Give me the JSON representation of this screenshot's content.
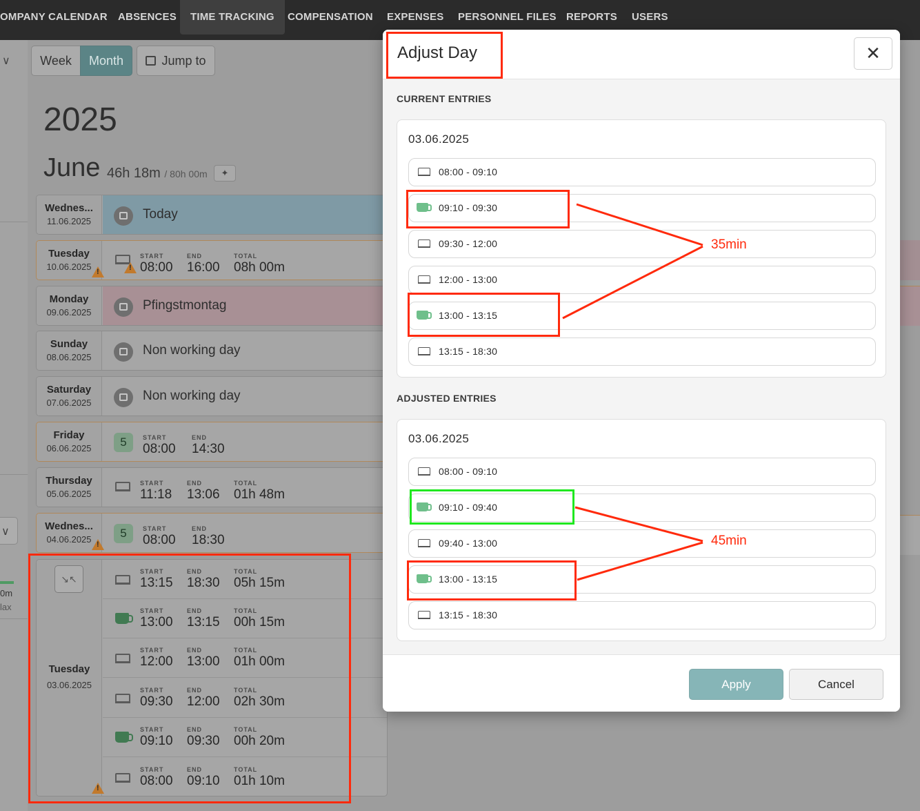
{
  "nav": {
    "items": [
      "OMPANY CALENDAR",
      "ABSENCES",
      "TIME TRACKING",
      "COMPENSATION",
      "EXPENSES",
      "PERSONNEL FILES",
      "REPORTS",
      "USERS"
    ],
    "active": "TIME TRACKING"
  },
  "toolbar": {
    "week": "Week",
    "month": "Month",
    "jump": "Jump to"
  },
  "calendar": {
    "year": "2025",
    "month": "June",
    "hours": "46h 18m",
    "target": "/ 80h 00m"
  },
  "labels": {
    "start": "START",
    "end": "END",
    "total": "TOTAL"
  },
  "days": [
    {
      "name": "Wednes...",
      "date": "11.06.2025",
      "type": "today",
      "label": "Today"
    },
    {
      "name": "Tuesday",
      "date": "10.06.2025",
      "type": "work",
      "start": "08:00",
      "end": "16:00",
      "total": "08h 00m"
    },
    {
      "name": "Monday",
      "date": "09.06.2025",
      "type": "holiday",
      "label": "Pfingstmontag"
    },
    {
      "name": "Sunday",
      "date": "08.06.2025",
      "type": "off",
      "label": "Non working day"
    },
    {
      "name": "Saturday",
      "date": "07.06.2025",
      "type": "off",
      "label": "Non working day"
    },
    {
      "name": "Friday",
      "date": "06.06.2025",
      "type": "badge",
      "badge": "5",
      "start": "08:00",
      "end": "14:30"
    },
    {
      "name": "Thursday",
      "date": "05.06.2025",
      "type": "work",
      "start": "11:18",
      "end": "13:06",
      "total": "01h 48m"
    },
    {
      "name": "Wednes...",
      "date": "04.06.2025",
      "type": "badge",
      "badge": "5",
      "start": "08:00",
      "end": "18:30"
    }
  ],
  "expanded_day": {
    "name": "Tuesday",
    "date": "03.06.2025",
    "entries": [
      {
        "kind": "work",
        "start": "13:15",
        "end": "18:30",
        "total": "05h 15m"
      },
      {
        "kind": "break",
        "start": "13:00",
        "end": "13:15",
        "total": "00h 15m"
      },
      {
        "kind": "work",
        "start": "12:00",
        "end": "13:00",
        "total": "01h 00m"
      },
      {
        "kind": "work",
        "start": "09:30",
        "end": "12:00",
        "total": "02h 30m"
      },
      {
        "kind": "break",
        "start": "09:10",
        "end": "09:30",
        "total": "00h 20m"
      },
      {
        "kind": "work",
        "start": "08:00",
        "end": "09:10",
        "total": "01h 10m"
      }
    ]
  },
  "sidebar_mini": {
    "line1": "0m",
    "line2": "lax"
  },
  "modal": {
    "title": "Adjust Day",
    "current_title": "CURRENT ENTRIES",
    "adjusted_title": "ADJUSTED ENTRIES",
    "current": {
      "date": "03.06.2025",
      "entries": [
        {
          "kind": "work",
          "time": "08:00 - 09:10"
        },
        {
          "kind": "break",
          "time": "09:10 - 09:30"
        },
        {
          "kind": "work",
          "time": "09:30 - 12:00"
        },
        {
          "kind": "work",
          "time": "12:00 - 13:00"
        },
        {
          "kind": "break",
          "time": "13:00 - 13:15"
        },
        {
          "kind": "work",
          "time": "13:15 - 18:30"
        }
      ]
    },
    "adjusted": {
      "date": "03.06.2025",
      "entries": [
        {
          "kind": "work",
          "time": "08:00 - 09:10"
        },
        {
          "kind": "break",
          "time": "09:10 - 09:40"
        },
        {
          "kind": "work",
          "time": "09:40 - 13:00"
        },
        {
          "kind": "break",
          "time": "13:00 - 13:15"
        },
        {
          "kind": "work",
          "time": "13:15 - 18:30"
        }
      ]
    },
    "apply": "Apply",
    "cancel": "Cancel"
  },
  "annotations": {
    "current_total": "35min",
    "adjusted_total": "45min"
  }
}
